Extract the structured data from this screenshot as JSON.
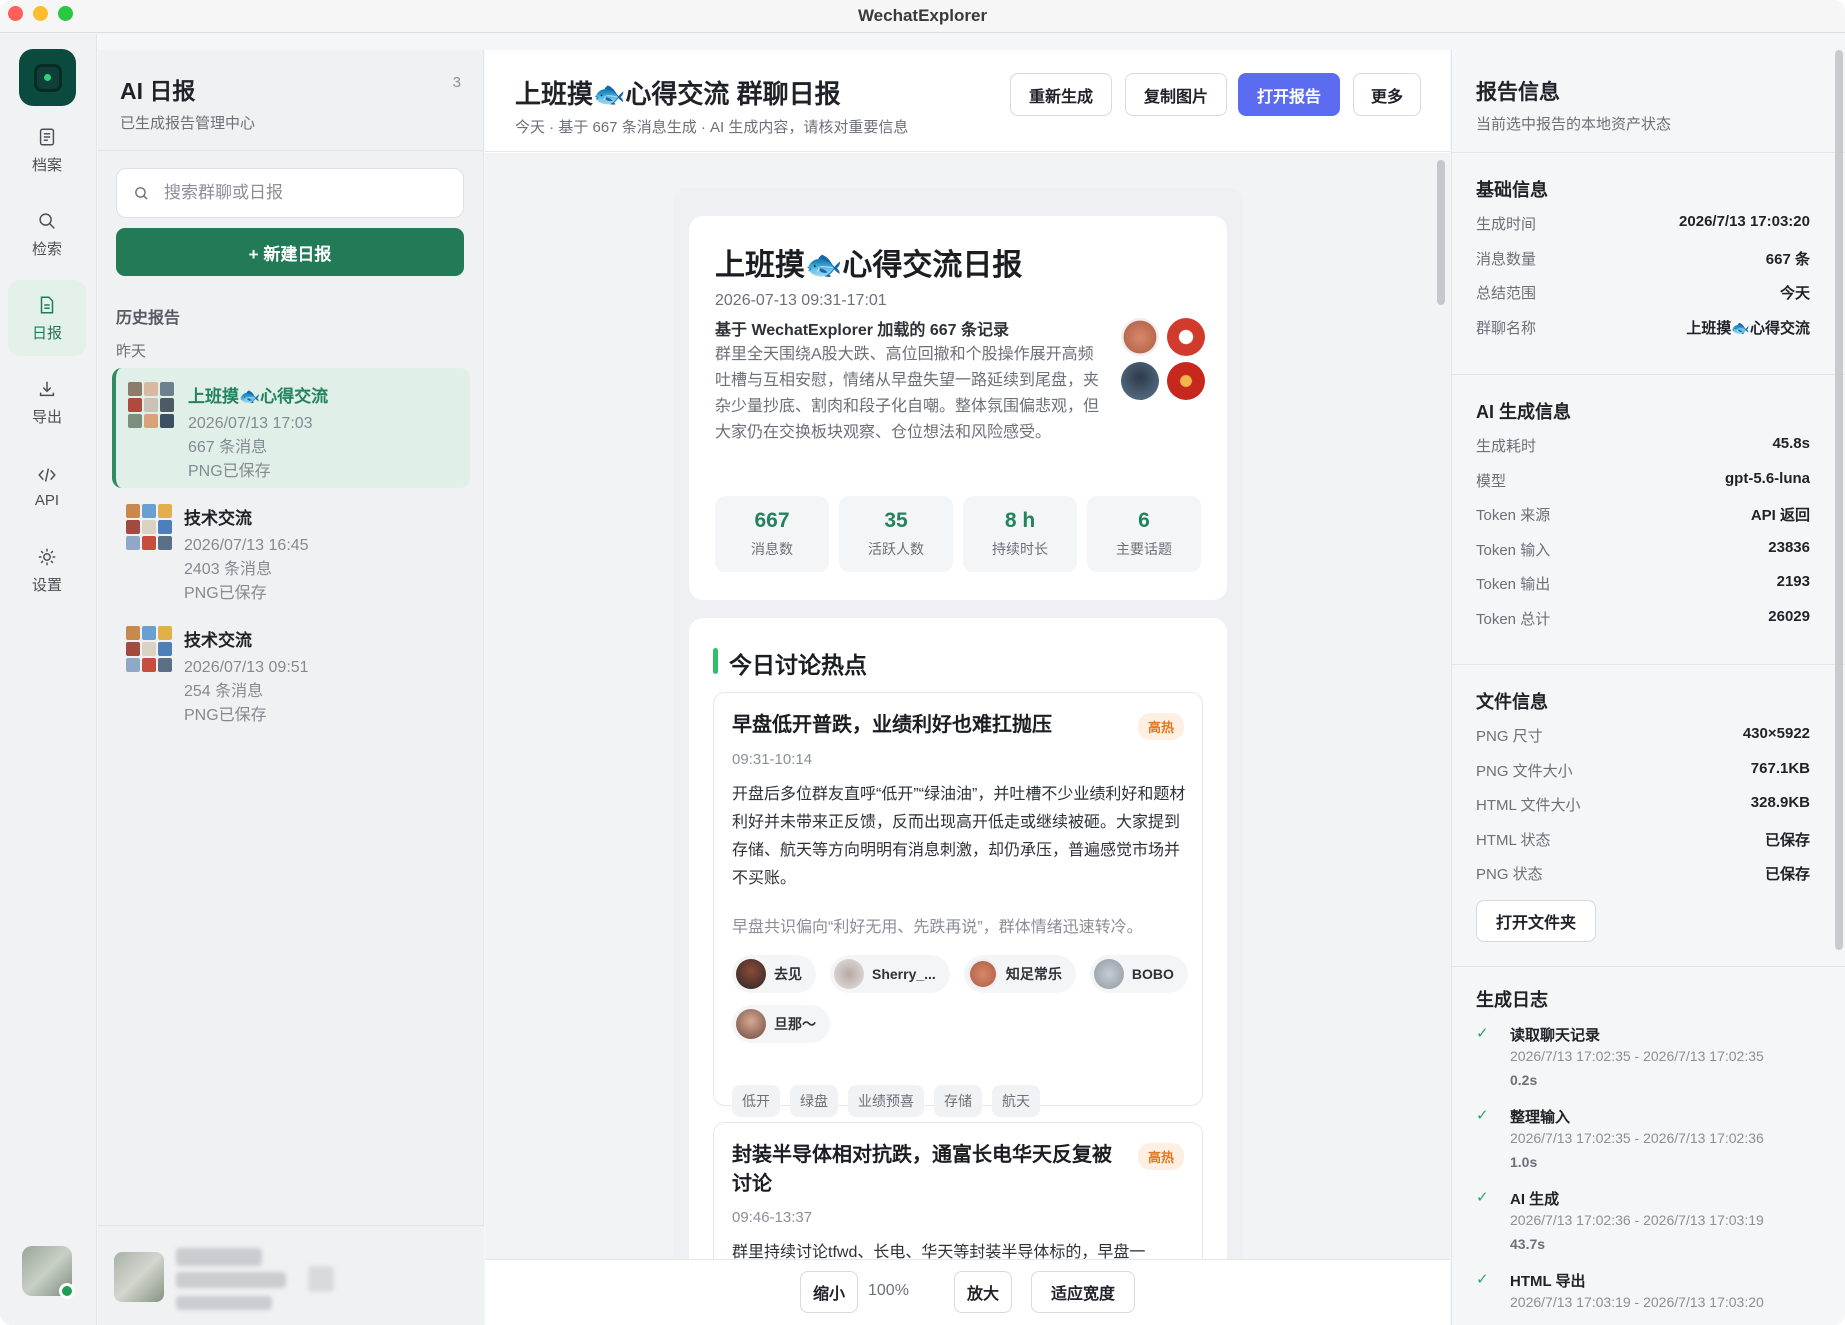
{
  "window": {
    "title": "WechatExplorer"
  },
  "rail": {
    "items": [
      {
        "label": "档案",
        "icon": "archive-icon"
      },
      {
        "label": "检索",
        "icon": "search-icon"
      },
      {
        "label": "日报",
        "icon": "report-icon"
      },
      {
        "label": "导出",
        "icon": "download-icon"
      },
      {
        "label": "API",
        "icon": "code-icon"
      },
      {
        "label": "设置",
        "icon": "gear-icon"
      }
    ],
    "active": "日报"
  },
  "list": {
    "title": "AI 日报",
    "subtitle": "已生成报告管理中心",
    "count": "3",
    "search_placeholder": "搜索群聊或日报",
    "new_button": "+ 新建日报",
    "section": "历史报告",
    "group": "昨天",
    "reports": [
      {
        "name": "上班摸🐟心得交流",
        "time": "2026/07/13 17:03",
        "messages": "667 条消息",
        "status": "PNG已保存"
      },
      {
        "name": "技术交流",
        "time": "2026/07/13 16:45",
        "messages": "2403 条消息",
        "status": "PNG已保存"
      },
      {
        "name": "技术交流",
        "time": "2026/07/13 09:51",
        "messages": "254 条消息",
        "status": "PNG已保存"
      }
    ]
  },
  "header": {
    "title": "上班摸🐟心得交流 群聊日报",
    "subtitle": "今天 · 基于 667 条消息生成 · AI 生成内容，请核对重要信息",
    "buttons": {
      "regenerate": "重新生成",
      "copy_image": "复制图片",
      "open_report": "打开报告",
      "more": "更多"
    }
  },
  "report": {
    "title": "上班摸🐟心得交流日报",
    "date": "2026-07-13 09:31-17:01",
    "basis": "基于 WechatExplorer 加载的 667 条记录",
    "summary": "群里全天围绕A股大跌、高位回撤和个股操作展开高频吐槽与互相安慰，情绪从早盘失望一路延续到尾盘，夹杂少量抄底、割肉和段子化自嘲。整体氛围偏悲观，但大家仍在交换板块观察、仓位想法和风险感受。",
    "stats": [
      {
        "value": "667",
        "label": "消息数"
      },
      {
        "value": "35",
        "label": "活跃人数"
      },
      {
        "value": "8 h",
        "label": "持续时长"
      },
      {
        "value": "6",
        "label": "主要话题"
      }
    ],
    "hot_title": "今日讨论热点",
    "topics": [
      {
        "name": "早盘低开普跌，业绩利好也难扛抛压",
        "badge": "高热",
        "time": "09:31-10:14",
        "body": "开盘后多位群友直呼“低开”“绿油油”，并吐槽不少业绩利好和题材利好并未带来正反馈，反而出现高开低走或继续被砸。大家提到存储、航天等方向明明有消息刺激，却仍承压，普遍感觉市场并不买账。",
        "note": "早盘共识偏向“利好无用、先跌再说”，群体情绪迅速转冷。",
        "people": [
          "去见",
          "Sherry_...",
          "知足常乐",
          "BOBO",
          "旦那～"
        ],
        "tags": [
          "低开",
          "绿盘",
          "业绩预喜",
          "存储",
          "航天"
        ]
      },
      {
        "name": "封装半导体相对抗跌，通富长电华天反复被讨论",
        "badge": "高热",
        "time": "09:46-13:37",
        "body": "群里持续讨论tfwd、长电、华天等封装半导体标的，早盘一"
      }
    ]
  },
  "zoom": {
    "out": "缩小",
    "value": "100%",
    "in": "放大",
    "fit": "适应宽度"
  },
  "info": {
    "title": "报告信息",
    "subtitle": "当前选中报告的本地资产状态",
    "basic": {
      "heading": "基础信息",
      "rows": [
        {
          "k": "生成时间",
          "v": "2026/7/13 17:03:20"
        },
        {
          "k": "消息数量",
          "v": "667 条"
        },
        {
          "k": "总结范围",
          "v": "今天"
        },
        {
          "k": "群聊名称",
          "v": "上班摸🐟心得交流"
        }
      ]
    },
    "ai": {
      "heading": "AI 生成信息",
      "rows": [
        {
          "k": "生成耗时",
          "v": "45.8s"
        },
        {
          "k": "模型",
          "v": "gpt-5.6-luna"
        },
        {
          "k": "Token 来源",
          "v": "API 返回"
        },
        {
          "k": "Token 输入",
          "v": "23836"
        },
        {
          "k": "Token 输出",
          "v": "2193"
        },
        {
          "k": "Token 总计",
          "v": "26029"
        }
      ]
    },
    "file": {
      "heading": "文件信息",
      "rows": [
        {
          "k": "PNG 尺寸",
          "v": "430×5922"
        },
        {
          "k": "PNG 文件大小",
          "v": "767.1KB"
        },
        {
          "k": "HTML 文件大小",
          "v": "328.9KB"
        },
        {
          "k": "HTML 状态",
          "v": "已保存"
        },
        {
          "k": "PNG 状态",
          "v": "已保存"
        }
      ],
      "button": "打开文件夹"
    },
    "log": {
      "heading": "生成日志",
      "entries": [
        {
          "name": "读取聊天记录",
          "range": "2026/7/13 17:02:35 - 2026/7/13 17:02:35",
          "dur": "0.2s"
        },
        {
          "name": "整理输入",
          "range": "2026/7/13 17:02:35 - 2026/7/13 17:02:36",
          "dur": "1.0s"
        },
        {
          "name": "AI 生成",
          "range": "2026/7/13 17:02:36 - 2026/7/13 17:03:19",
          "dur": "43.7s"
        },
        {
          "name": "HTML 导出",
          "range": "2026/7/13 17:03:19 - 2026/7/13 17:03:20",
          "dur": ""
        }
      ]
    }
  },
  "colors": {
    "accent": "#227a57",
    "primary_button": "#5b6cf0",
    "hot_badge": "#e07a22",
    "stat_value": "#23835c"
  }
}
